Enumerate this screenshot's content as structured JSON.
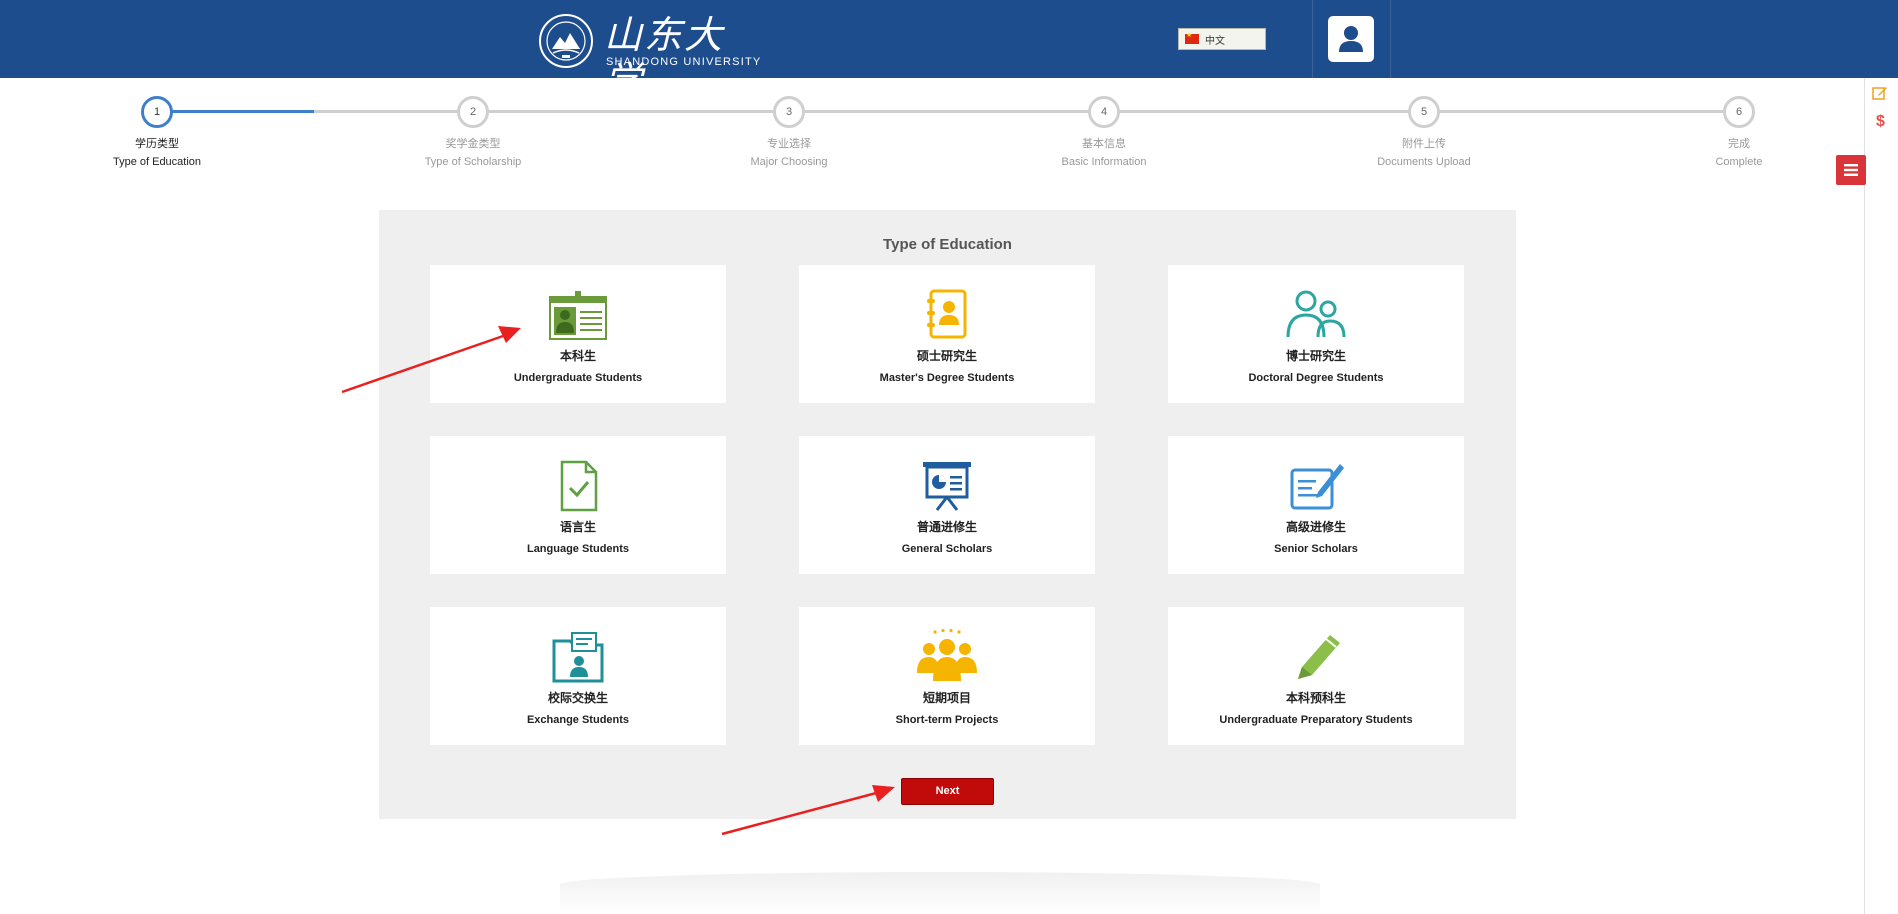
{
  "header": {
    "logo_cn": "山东大学",
    "logo_en": "SHANDONG UNIVERSITY",
    "language": "中文"
  },
  "steps": [
    {
      "num": "1",
      "cn": "学历类型",
      "en": "Type of Education"
    },
    {
      "num": "2",
      "cn": "奖学金类型",
      "en": "Type of Scholarship"
    },
    {
      "num": "3",
      "cn": "专业选择",
      "en": "Major Choosing"
    },
    {
      "num": "4",
      "cn": "基本信息",
      "en": "Basic Information"
    },
    {
      "num": "5",
      "cn": "附件上传",
      "en": "Documents Upload"
    },
    {
      "num": "6",
      "cn": "完成",
      "en": "Complete"
    }
  ],
  "current_step": 1,
  "panel": {
    "title": "Type of Education",
    "cards": [
      {
        "cn": "本科生",
        "en": "Undergraduate Students",
        "icon": "id-card-icon",
        "color": "#6a9a3a"
      },
      {
        "cn": "硕士研究生",
        "en": "Master's Degree Students",
        "icon": "contact-book-icon",
        "color": "#f4b400"
      },
      {
        "cn": "博士研究生",
        "en": "Doctoral Degree Students",
        "icon": "two-users-icon",
        "color": "#2ca6a0"
      },
      {
        "cn": "语言生",
        "en": "Language Students",
        "icon": "document-check-icon",
        "color": "#5ea042"
      },
      {
        "cn": "普通进修生",
        "en": "General Scholars",
        "icon": "presentation-board-icon",
        "color": "#1f5e9e"
      },
      {
        "cn": "高级进修生",
        "en": "Senior Scholars",
        "icon": "pen-paper-icon",
        "color": "#3a8fd6"
      },
      {
        "cn": "校际交换生",
        "en": "Exchange Students",
        "icon": "folder-user-icon",
        "color": "#1f8f9a"
      },
      {
        "cn": "短期项目",
        "en": "Short-term Projects",
        "icon": "group-people-icon",
        "color": "#f4b400"
      },
      {
        "cn": "本科预科生",
        "en": "Undergraduate Preparatory Students",
        "icon": "pencil-icon",
        "color": "#8cbf4a"
      }
    ],
    "next_label": "Next"
  },
  "colors": {
    "header_bg": "#1e4d8e",
    "accent": "#3f7fca",
    "next_button": "#c10a0a",
    "annotation_arrow": "#e8201f"
  }
}
